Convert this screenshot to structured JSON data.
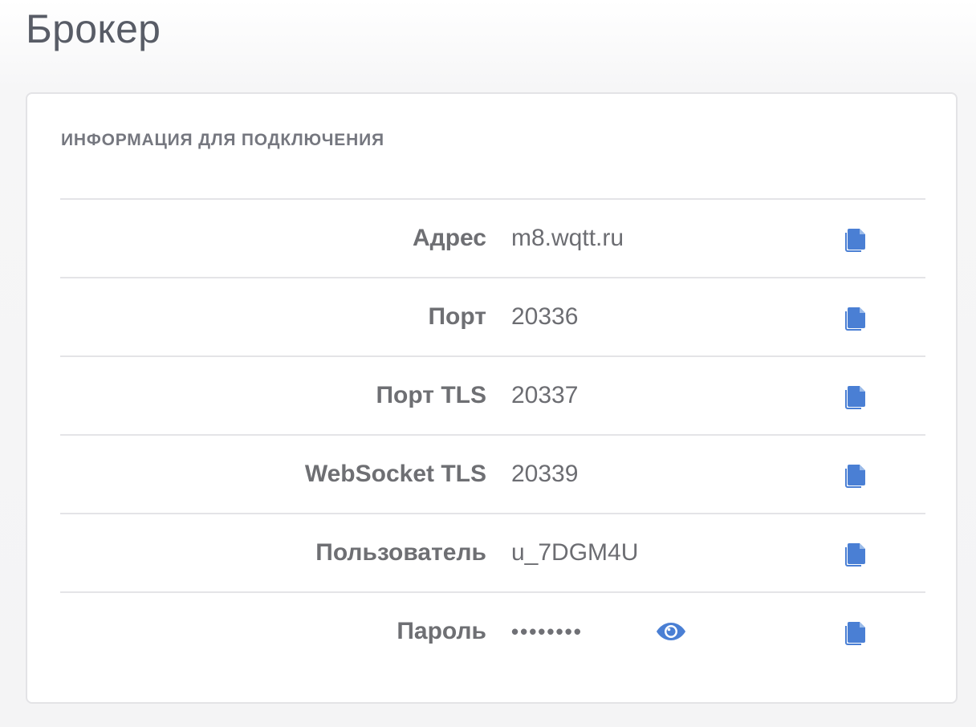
{
  "page": {
    "title": "Брокер"
  },
  "connection_info": {
    "heading": "ИНФОРМАЦИЯ ДЛЯ ПОДКЛЮЧЕНИЯ",
    "rows": [
      {
        "label": "Адрес",
        "value": "m8.wqtt.ru",
        "copy_icon": "copy-icon"
      },
      {
        "label": "Порт",
        "value": "20336",
        "copy_icon": "copy-icon"
      },
      {
        "label": "Порт TLS",
        "value": "20337",
        "copy_icon": "copy-icon"
      },
      {
        "label": "WebSocket TLS",
        "value": "20339",
        "copy_icon": "copy-icon"
      },
      {
        "label": "Пользователь",
        "value": "u_7DGM4U",
        "copy_icon": "copy-icon"
      },
      {
        "label": "Пароль",
        "value": "••••••••",
        "masked": true,
        "reveal_icon": "eye-icon",
        "copy_icon": "copy-icon"
      }
    ]
  },
  "colors": {
    "accent": "#4a7fd4",
    "title_text": "#585c66",
    "label_text": "#6e6f73",
    "value_text": "#6c6d72",
    "divider": "#e4e4e7",
    "card_border": "#e3e3e6"
  }
}
